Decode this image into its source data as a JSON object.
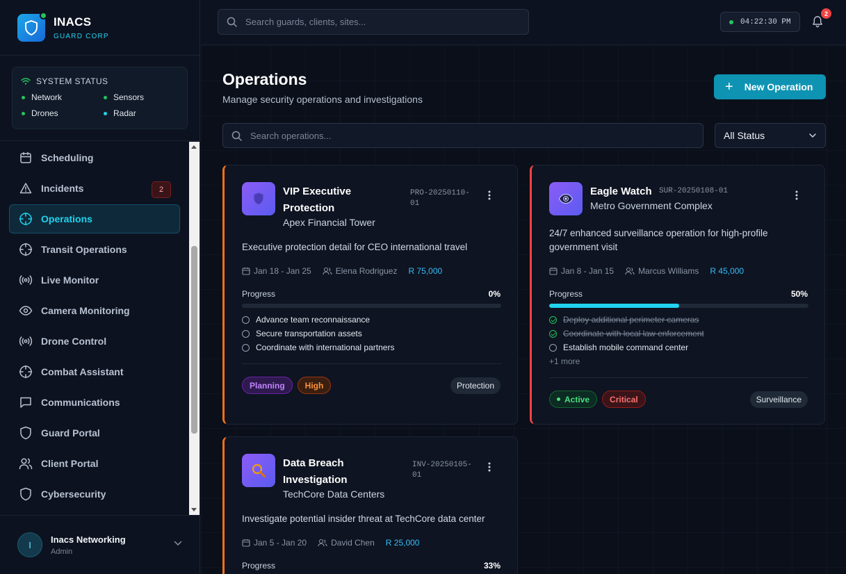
{
  "brand": {
    "title": "INACS",
    "subtitle": "GUARD CORP"
  },
  "system_status": {
    "title": "SYSTEM STATUS",
    "items": [
      {
        "label": "Network",
        "color": "#22c55e"
      },
      {
        "label": "Sensors",
        "color": "#22c55e"
      },
      {
        "label": "Drones",
        "color": "#22c55e"
      },
      {
        "label": "Radar",
        "color": "#22d3ee"
      }
    ]
  },
  "nav": {
    "items": [
      {
        "label": "Scheduling",
        "icon": "calendar-icon"
      },
      {
        "label": "Incidents",
        "icon": "warning-icon",
        "badge": "2"
      },
      {
        "label": "Operations",
        "icon": "crosshair-icon",
        "active": true
      },
      {
        "label": "Transit Operations",
        "icon": "crosshair-icon"
      },
      {
        "label": "Live Monitor",
        "icon": "broadcast-icon"
      },
      {
        "label": "Camera Monitoring",
        "icon": "eye-icon"
      },
      {
        "label": "Drone Control",
        "icon": "broadcast-icon"
      },
      {
        "label": "Combat Assistant",
        "icon": "crosshair-icon"
      },
      {
        "label": "Communications",
        "icon": "chat-icon"
      },
      {
        "label": "Guard Portal",
        "icon": "shield-icon"
      },
      {
        "label": "Client Portal",
        "icon": "users-icon"
      },
      {
        "label": "Cybersecurity",
        "icon": "shield-icon"
      }
    ]
  },
  "user": {
    "initial": "I",
    "name": "Inacs Networking",
    "role": "Admin"
  },
  "topbar": {
    "search_placeholder": "Search guards, clients, sites...",
    "clock": "04:22:30 PM",
    "notifications": "2"
  },
  "page": {
    "title": "Operations",
    "subtitle": "Manage security operations and investigations",
    "new_button": "New Operation",
    "search_placeholder": "Search operations...",
    "status_filter": "All Status"
  },
  "operations": [
    {
      "title": "VIP Executive Protection",
      "code_line1": "PRO-20250110-",
      "code_line2": "01",
      "client": "Apex Financial Tower",
      "description": "Executive protection detail for CEO international travel",
      "dates": "Jan 18 - Jan 25",
      "lead": "Elena Rodriguez",
      "budget": "R 75,000",
      "progress_label": "Progress",
      "progress": "0%",
      "progress_value": 0,
      "tasks": [
        {
          "label": "Advance team reconnaissance",
          "done": false
        },
        {
          "label": "Secure transportation assets",
          "done": false
        },
        {
          "label": "Coordinate with international partners",
          "done": false
        }
      ],
      "status": "Planning",
      "priority": "High",
      "type": "Protection"
    },
    {
      "title": "Eagle Watch",
      "code_line1": "SUR-20250108-01",
      "client": "Metro Government Complex",
      "description": "24/7 enhanced surveillance operation for high-profile government visit",
      "dates": "Jan 8 - Jan 15",
      "lead": "Marcus Williams",
      "budget": "R 45,000",
      "progress_label": "Progress",
      "progress": "50%",
      "progress_value": 50,
      "tasks": [
        {
          "label": "Deploy additional perimeter cameras",
          "done": true
        },
        {
          "label": "Coordinate with local law enforcement",
          "done": true
        },
        {
          "label": "Establish mobile command center",
          "done": false
        }
      ],
      "more": "+1 more",
      "status": "Active",
      "priority": "Critical",
      "type": "Surveillance"
    },
    {
      "title": "Data Breach Investigation",
      "code_line1": "INV-20250105-",
      "code_line2": "01",
      "client": "TechCore Data Centers",
      "description": "Investigate potential insider threat at TechCore data center",
      "dates": "Jan 5 - Jan 20",
      "lead": "David Chen",
      "budget": "R 25,000",
      "progress_label": "Progress",
      "progress": "33%",
      "progress_value": 33
    }
  ]
}
